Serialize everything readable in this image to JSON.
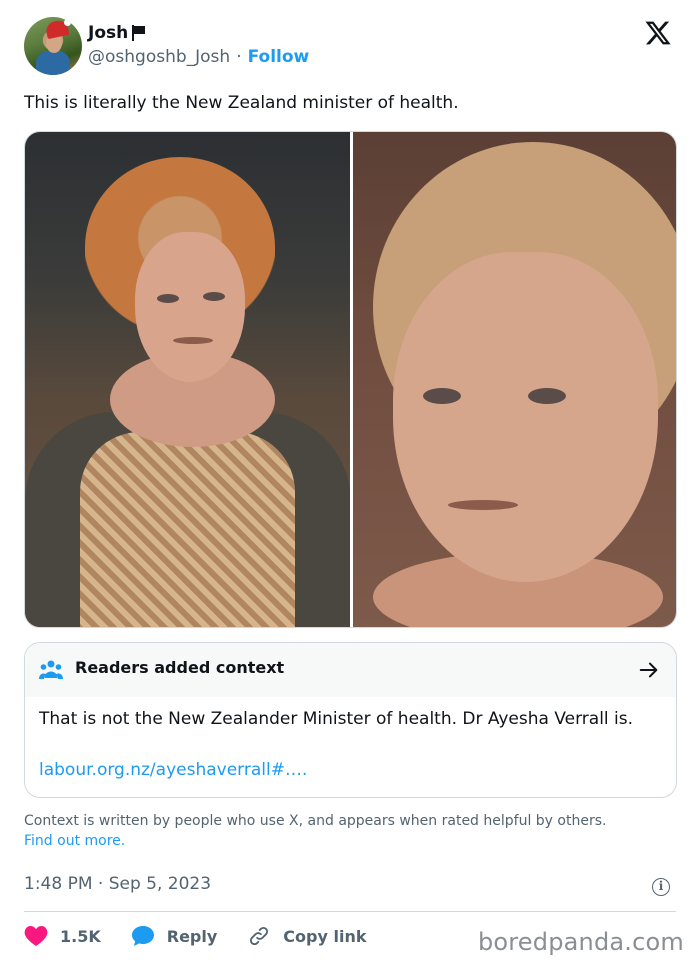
{
  "author": {
    "display_name": "Josh",
    "handle": "@oshgoshb_Josh",
    "separator": "·",
    "follow_label": "Follow"
  },
  "tweet": {
    "text": "This is literally the New Zealand minister of health."
  },
  "context": {
    "title": "Readers added context",
    "body": "That is not the New Zealander Minister of health. Dr Ayesha Verrall is.",
    "link": "labour.org.nz/ayeshaverrall#…."
  },
  "disclaimer": {
    "text": "Context is written by people who use X, and appears when rated helpful by others.",
    "link": "Find out more."
  },
  "timestamp": "1:48 PM · Sep 5, 2023",
  "actions": {
    "like_count": "1.5K",
    "reply_label": "Reply",
    "copy_label": "Copy link"
  },
  "watermark": "boredpanda.com",
  "colors": {
    "accent": "#1d9bf0",
    "like": "#f91880",
    "text_secondary": "#536471"
  }
}
